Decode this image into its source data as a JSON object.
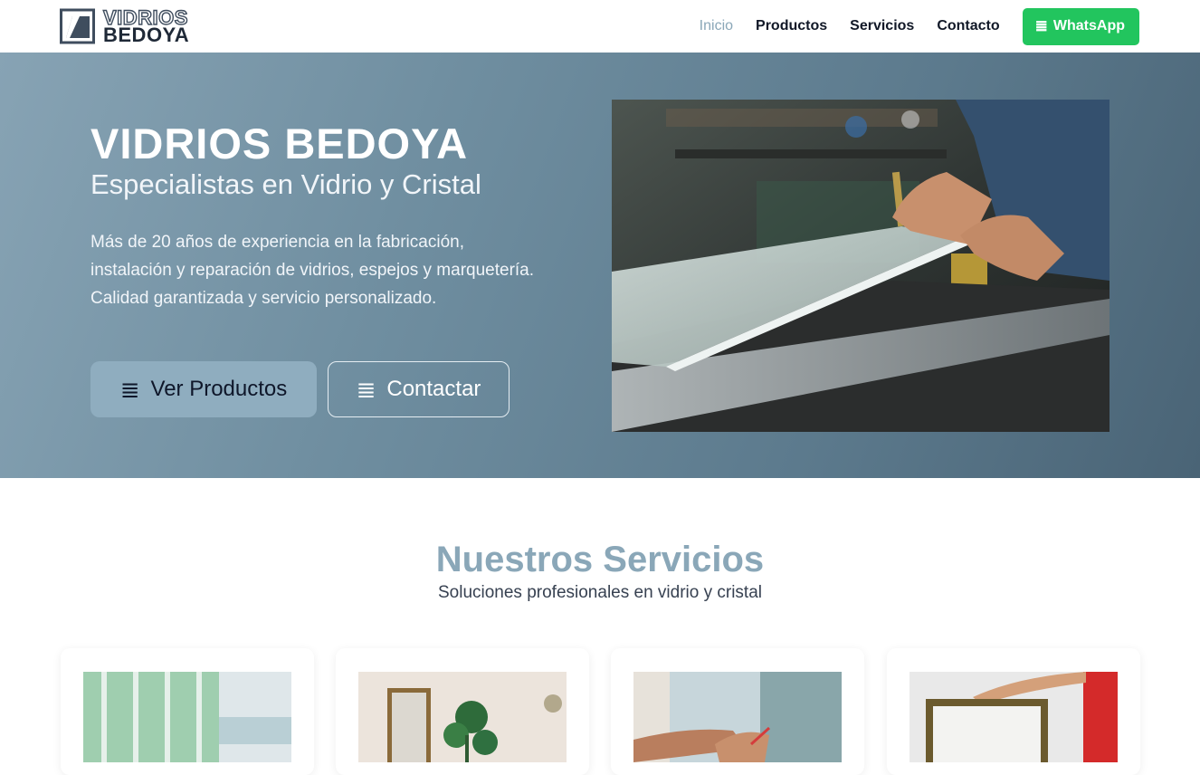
{
  "brand": {
    "line1": "VIDRIOS",
    "line2": "BEDOYA"
  },
  "nav": {
    "items": [
      {
        "label": "Inicio",
        "active": true
      },
      {
        "label": "Productos",
        "active": false
      },
      {
        "label": "Servicios",
        "active": false
      },
      {
        "label": "Contacto",
        "active": false
      }
    ],
    "whatsapp": {
      "label": "WhatsApp",
      "icon": "whatsapp-icon"
    }
  },
  "hero": {
    "title": "VIDRIOS BEDOYA",
    "subtitle": "Especialistas en Vidrio y Cristal",
    "description": "Más de 20 años de experiencia en la fabricación, instalación y reparación de vidrios, espejos y marquetería. Calidad garantizada y servicio personalizado.",
    "primary_button": {
      "label": "Ver Productos",
      "icon": "list-icon"
    },
    "secondary_button": {
      "label": "Contactar",
      "icon": "list-icon"
    },
    "image_alt": "Cutting glass sheet on workbench"
  },
  "services": {
    "title": "Nuestros Servicios",
    "subtitle": "Soluciones profesionales en vidrio y cristal",
    "cards": [
      {
        "image": "glass-facade"
      },
      {
        "image": "mirror-with-plant"
      },
      {
        "image": "glass-repair-hands"
      },
      {
        "image": "picture-frame"
      }
    ]
  },
  "colors": {
    "accent": "#8aa7b8",
    "whatsapp": "#22c55e",
    "hero_start": "#87a3b4",
    "hero_end": "#4a6476"
  }
}
